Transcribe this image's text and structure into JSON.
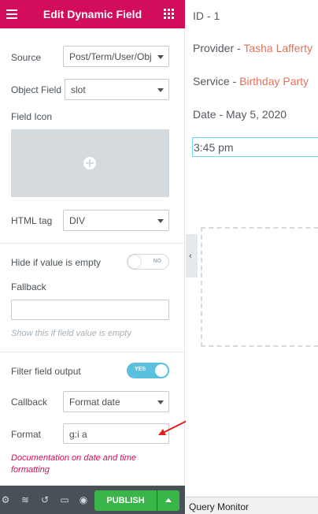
{
  "header": {
    "title": "Edit Dynamic Field",
    "menu_icon": "hamburger-menu-icon",
    "apps_icon": "grid-icon"
  },
  "controls": {
    "source": {
      "label": "Source",
      "value": "Post/Term/User/Obj"
    },
    "object_field": {
      "label": "Object Field",
      "value": "slot"
    },
    "field_icon": {
      "label": "Field Icon"
    },
    "html_tag": {
      "label": "HTML tag",
      "value": "DIV"
    },
    "hide_if_empty": {
      "label": "Hide if value is empty",
      "toggle_text": "NO",
      "enabled": false
    },
    "fallback": {
      "label": "Fallback",
      "value": "",
      "hint": "Show this if field value is empty"
    },
    "filter_output": {
      "label": "Filter field output",
      "toggle_text": "YES",
      "enabled": true
    },
    "callback": {
      "label": "Callback",
      "value": "Format date"
    },
    "format": {
      "label": "Format",
      "value": "g:i a"
    },
    "doc_link": "Documentation on date and time formatting"
  },
  "footer": {
    "publish_label": "PUBLISH",
    "icons": [
      "settings-icon",
      "layers-icon",
      "history-icon",
      "responsive-icon",
      "preview-eye-icon"
    ]
  },
  "preview": {
    "id_line": "ID - 1",
    "provider_label": "Provider - ",
    "provider_value": "Tasha Lafferty",
    "service_label": "Service - ",
    "service_value": "Birthday Party",
    "date_line": "Date - May 5, 2020",
    "time_value": "3:45 pm"
  },
  "admin_bar": {
    "query_monitor": "Query Monitor"
  },
  "colors": {
    "header": "#d30c5c",
    "publish": "#39b54a",
    "link": "#e2725b",
    "toggle_on": "#5bc0de",
    "arrow": "#e0201e"
  }
}
